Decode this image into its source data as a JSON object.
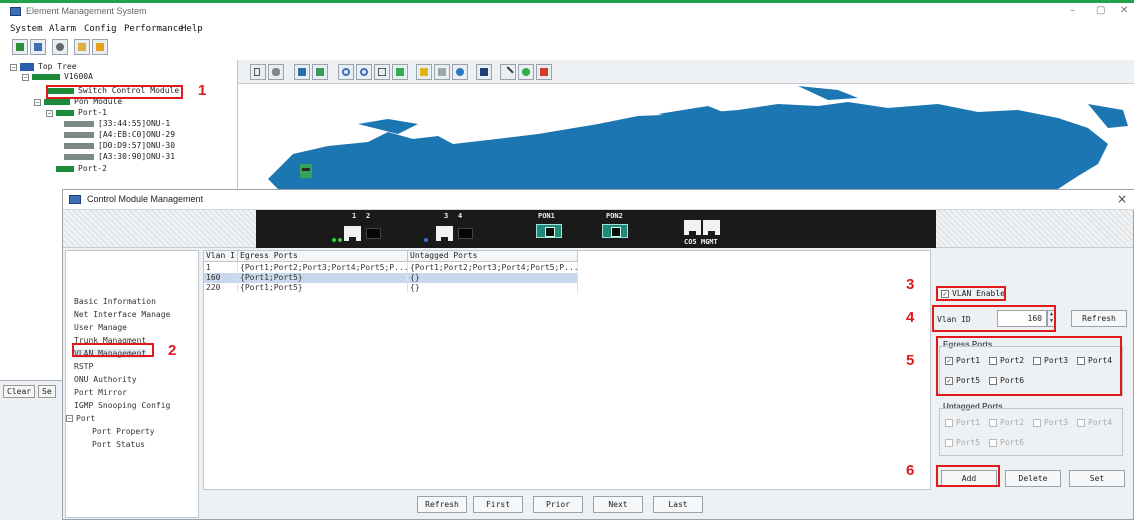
{
  "window": {
    "title": "Element Management System",
    "controls": [
      "–",
      "▢",
      "✕"
    ]
  },
  "menu": [
    "System",
    "Alarm",
    "Config",
    "Performance",
    "Help"
  ],
  "tree": {
    "root": "Top Tree",
    "device": "V1600A",
    "switch_module": "Switch Control Module",
    "pon_module": "Pon Module",
    "port1": "Port-1",
    "onus": [
      "[33:44:55]ONU-1",
      "[A4:EB:C0]ONU-29",
      "[D0:D9:57]ONU-30",
      "[A3:30:90]ONU-31"
    ],
    "port2": "Port-2"
  },
  "lower_buttons": [
    "Clear",
    "Se"
  ],
  "dialog": {
    "title": "Control Module Management",
    "close": "×",
    "device_labels": [
      "1",
      "2",
      "3",
      "4",
      "PON1",
      "PON2",
      "CO5 MGMT"
    ],
    "nav": [
      "Basic Information",
      "Net Interface Manage",
      "User Manage",
      "Trunk Managment",
      "VLAN Management",
      "RSTP",
      "ONU Authority",
      "Port Mirror",
      "IGMP Snooping Config",
      "Port",
      "Port Property",
      "Port Status"
    ],
    "table": {
      "headers": [
        "Vlan I",
        "Egress Ports",
        "Untagged Ports"
      ],
      "rows": [
        [
          "1",
          "{Port1;Port2;Port3;Port4;Port5;P...",
          "{Port1;Port2;Port3;Port4;Port5;P..."
        ],
        [
          "160",
          "{Port1;Port5}",
          "{}"
        ],
        [
          "220",
          "{Port1;Port5}",
          "{}"
        ]
      ]
    },
    "nav_buttons": [
      "Refresh",
      "First",
      "Prior",
      "Next",
      "Last"
    ],
    "vlan_enable": "VLAN Enable",
    "vlan_id_label": "Vlan ID",
    "vlan_id_value": "160",
    "refresh": "Refresh",
    "egress_title": "Egress Ports",
    "egress_ports": [
      "Port1",
      "Port2",
      "Port3",
      "Port4",
      "Port5",
      "Port6"
    ],
    "untagged_title": "Untagged Ports",
    "untagged_ports": [
      "Port1",
      "Port2",
      "Port3",
      "Port4",
      "Port5",
      "Port6"
    ],
    "actions": [
      "Add",
      "Delete",
      "Set"
    ]
  },
  "callouts": [
    "1",
    "2",
    "3",
    "4",
    "5",
    "6"
  ],
  "colors": {
    "highlight": "#e0191b",
    "accent": "#1fa34a",
    "map": "#1b76b2"
  }
}
